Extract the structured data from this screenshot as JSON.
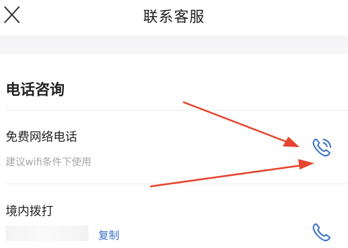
{
  "header": {
    "title": "联系客服",
    "close_icon": "close-icon"
  },
  "section": {
    "title": "电话咨询"
  },
  "items": [
    {
      "label": "免费网络电话",
      "sub": "建议wifi条件下使用",
      "icon": "wifi-phone-icon"
    },
    {
      "label": "境内拨打",
      "action": "复制",
      "icon": "phone-icon"
    }
  ],
  "colors": {
    "accent": "#3a73c7",
    "annotation_arrow": "#e5452f"
  }
}
